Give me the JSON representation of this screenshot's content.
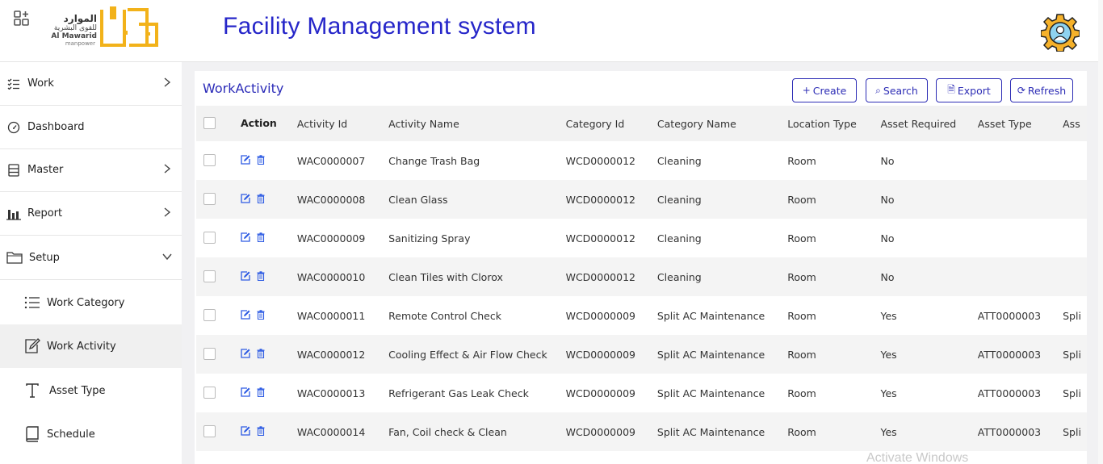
{
  "header": {
    "title": "Facility Management system",
    "logo_arabic": "الموارد",
    "logo_arabic_sub": "للقوى البشرية",
    "logo_english": "Al Mawarid",
    "logo_tagline": "manpower",
    "logo_color": "#f2b21a",
    "title_color": "#2626c9"
  },
  "sidebar": {
    "items": [
      {
        "label": "Work",
        "icon": "list-check-icon",
        "has_chevron": true,
        "chevron": "right"
      },
      {
        "label": "Dashboard",
        "icon": "gauge-icon",
        "has_chevron": false
      },
      {
        "label": "Master",
        "icon": "stack-icon",
        "has_chevron": true,
        "chevron": "right"
      },
      {
        "label": "Report",
        "icon": "bar-chart-icon",
        "has_chevron": true,
        "chevron": "right"
      },
      {
        "label": "Setup",
        "icon": "folder-icon",
        "has_chevron": true,
        "chevron": "down"
      }
    ],
    "subitems": [
      {
        "label": "Work Category",
        "icon": "list-icon"
      },
      {
        "label": "Work Activity",
        "icon": "edit-icon",
        "active": true
      },
      {
        "label": "Asset Type",
        "icon": "text-icon"
      },
      {
        "label": "Schedule",
        "icon": "book-icon"
      }
    ]
  },
  "main": {
    "title": "WorkActivity",
    "buttons": {
      "create": "Create",
      "search": "Search",
      "export": "Export",
      "refresh": "Refresh"
    },
    "columns": [
      "Action",
      "Activity Id",
      "Activity Name",
      "Category Id",
      "Category Name",
      "Location Type",
      "Asset Required",
      "Asset Type",
      "Ass"
    ],
    "rows": [
      [
        "WAC0000007",
        "Change Trash Bag",
        "WCD0000012",
        "Cleaning",
        "Room",
        "No",
        "",
        ""
      ],
      [
        "WAC0000008",
        "Clean Glass",
        "WCD0000012",
        "Cleaning",
        "Room",
        "No",
        "",
        ""
      ],
      [
        "WAC0000009",
        "Sanitizing Spray",
        "WCD0000012",
        "Cleaning",
        "Room",
        "No",
        "",
        ""
      ],
      [
        "WAC0000010",
        "Clean Tiles with Clorox",
        "WCD0000012",
        "Cleaning",
        "Room",
        "No",
        "",
        ""
      ],
      [
        "WAC0000011",
        "Remote Control Check",
        "WCD0000009",
        "Split AC Maintenance",
        "Room",
        "Yes",
        "ATT0000003",
        "Spli"
      ],
      [
        "WAC0000012",
        "Cooling Effect & Air Flow Check",
        "WCD0000009",
        "Split AC Maintenance",
        "Room",
        "Yes",
        "ATT0000003",
        "Spli"
      ],
      [
        "WAC0000013",
        "Refrigerant Gas Leak Check",
        "WCD0000009",
        "Split AC Maintenance",
        "Room",
        "Yes",
        "ATT0000003",
        "Spli"
      ],
      [
        "WAC0000014",
        "Fan, Coil check & Clean",
        "WCD0000009",
        "Split AC Maintenance",
        "Room",
        "Yes",
        "ATT0000003",
        "Spli"
      ]
    ]
  },
  "watermark": "Activate Windows"
}
